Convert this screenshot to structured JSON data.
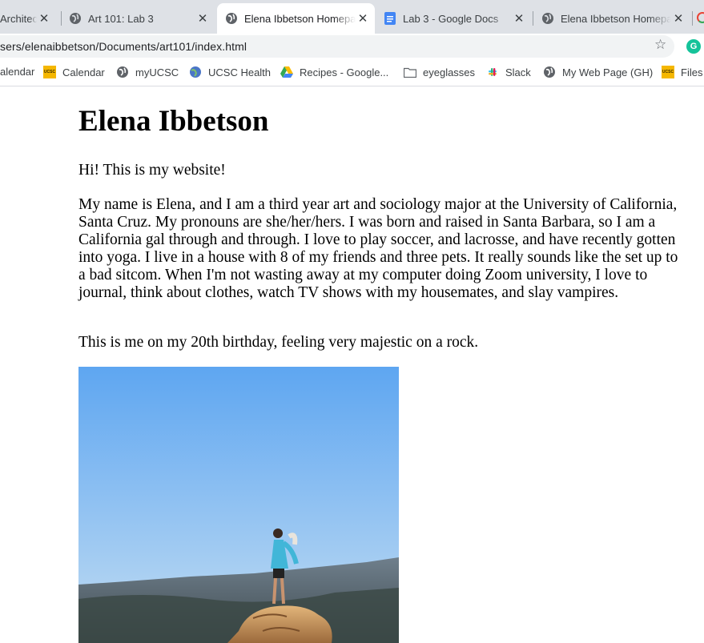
{
  "browser": {
    "tabs": [
      {
        "title": "Architecture and",
        "icon": "none",
        "active": false
      },
      {
        "title": "Art 101: Lab 3",
        "icon": "globe-icon",
        "active": false
      },
      {
        "title": "Elena Ibbetson Homepage",
        "icon": "globe-icon",
        "active": true
      },
      {
        "title": "Lab 3 - Google Docs",
        "icon": "docs-icon",
        "active": false
      },
      {
        "title": "Elena Ibbetson Homepage",
        "icon": "globe-icon",
        "active": false
      }
    ],
    "address": "sers/elenaibbetson/Documents/art101/index.html",
    "bookmarks": [
      {
        "label": "alendar",
        "icon": "none"
      },
      {
        "label": "Calendar",
        "icon": "ucsc-icon"
      },
      {
        "label": "myUCSC",
        "icon": "globe-icon"
      },
      {
        "label": "UCSC Health",
        "icon": "globe-icon"
      },
      {
        "label": "Recipes - Google...",
        "icon": "drive-icon"
      },
      {
        "label": "eyeglasses",
        "icon": "folder-icon"
      },
      {
        "label": "Slack",
        "icon": "slack-icon"
      },
      {
        "label": "My Web Page (GH)",
        "icon": "globe-icon"
      },
      {
        "label": "Files",
        "icon": "ucsc-icon"
      }
    ],
    "ucsc_badge": "UCSC"
  },
  "page": {
    "heading": "Elena Ibbetson",
    "intro": "Hi! This is my website!",
    "bio": "My name is Elena, and I am a third year art and sociology major at the University of California, Santa Cruz. My pronouns are she/her/hers. I was born and raised in Santa Barbara, so I am a California gal through and through. I love to play soccer, and lacrosse, and have recently gotten into yoga. I live in a house with 8 of my friends and three pets. It really sounds like the set up to a bad sitcom. When I'm not wasting away at my computer doing Zoom university, I love to journal, think about clothes, watch TV shows with my housemates, and slay vampires.",
    "caption": "This is me on my 20th birthday, feeling very majestic on a rock."
  },
  "colors": {
    "chrome_bg": "#dee1e6",
    "sky_top": "#5fa8f2",
    "sky_bottom": "#b9d9f3",
    "grammarly": "#15c39a"
  }
}
